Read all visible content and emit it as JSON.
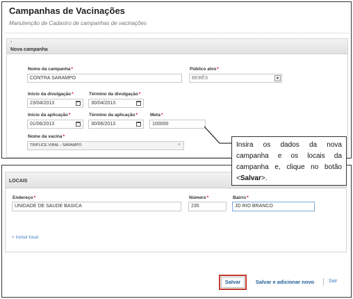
{
  "page": {
    "title": "Campanhas de Vacinações",
    "subtitle": "Manutenção de Cadastro de campanhas de vacinações"
  },
  "nova_campanha": {
    "header": "Nova campanha",
    "nome_label": "Nome da campanha",
    "nome_value": "CONTRA SARAMPO",
    "publico_label": "Público alvo",
    "publico_value": "BEBÊS",
    "inicio_div_label": "Início da divulgação",
    "inicio_div_value": "23/04/2013",
    "termino_div_label": "Término da divulgação",
    "termino_div_value": "30/04/2013",
    "inicio_apl_label": "Início da aplicação",
    "inicio_apl_value": "01/06/2013",
    "termino_apl_label": "Término da aplicação",
    "termino_apl_value": "30/06/2013",
    "meta_label": "Meta",
    "meta_value": "100000",
    "vacina_label": "Nome da vacina",
    "vacina_value": "TRIPLICE VIRAL - SARAMPO"
  },
  "callout": {
    "text_before": "Insira os dados da nova campanha e os locais da campanha e, clique no botão <",
    "bold": "Salvar",
    "text_after": ">."
  },
  "locais": {
    "header": "LOCAIS",
    "endereco_label": "Endereço",
    "endereco_value": "UNIDADE DE SAUDE BASICA",
    "numero_label": "Número",
    "numero_value": "235",
    "bairro_label": "Bairro",
    "bairro_value": "JD RIO BRANCO",
    "add_link": "+ Incluir local"
  },
  "actions": {
    "salvar": "Salvar",
    "salvar_novo": "Salvar e adicionar novo",
    "sair": "Sair"
  },
  "colors": {
    "required": "#d9002a",
    "link": "#3a7dbf",
    "highlight": "#c0392b"
  }
}
